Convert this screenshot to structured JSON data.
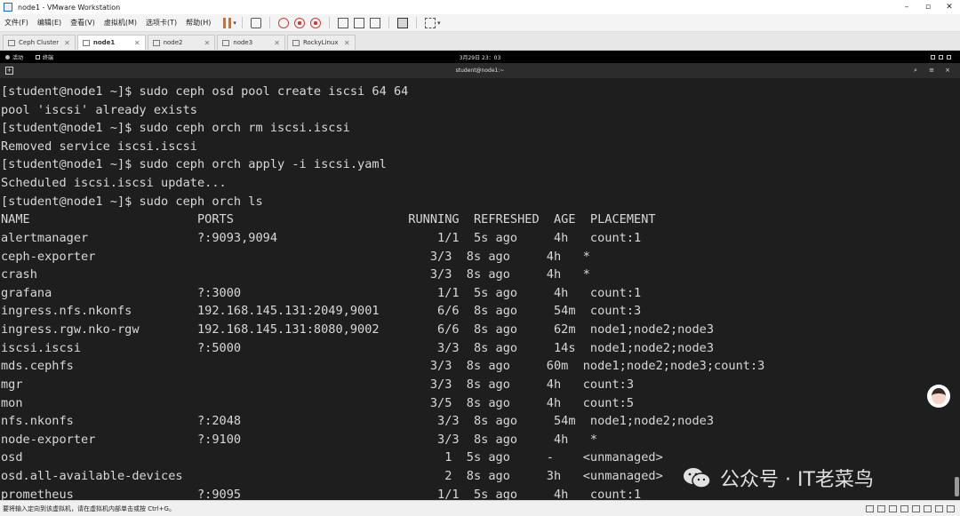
{
  "window": {
    "title": "node1 - VMware Workstation",
    "minimize_glyph": "–",
    "maximize_glyph": "▫",
    "close_glyph": "✕"
  },
  "menubar": {
    "items": [
      "文件(F)",
      "编辑(E)",
      "查看(V)",
      "虚拟机(M)",
      "选项卡(T)",
      "帮助(H)"
    ],
    "pause_color": "#e46a1b"
  },
  "tabs": [
    {
      "label": "Ceph Cluster",
      "active": false
    },
    {
      "label": "node1",
      "active": true
    },
    {
      "label": "node2",
      "active": false
    },
    {
      "label": "node3",
      "active": false
    },
    {
      "label": "RockyLinux",
      "active": false
    }
  ],
  "guest_topbar": {
    "activities": "活动",
    "app": "终端",
    "clock": "3月29日 23：03"
  },
  "terminal_header": {
    "title": "student@node1:~",
    "new_tab_glyph": "+",
    "search_glyph": "⌕",
    "menu_glyph": "≡",
    "close_glyph": "×"
  },
  "terminal": {
    "lines": [
      "[student@node1 ~]$ sudo ceph osd pool create iscsi 64 64",
      "pool 'iscsi' already exists",
      "[student@node1 ~]$ sudo ceph orch rm iscsi.iscsi",
      "Removed service iscsi.iscsi",
      "[student@node1 ~]$ sudo ceph orch apply -i iscsi.yaml",
      "Scheduled iscsi.iscsi update...",
      "[student@node1 ~]$ sudo ceph orch ls",
      "NAME                       PORTS                        RUNNING  REFRESHED  AGE  PLACEMENT",
      "alertmanager               ?:9093,9094                      1/1  5s ago     4h   count:1",
      "ceph-exporter                                              3/3  8s ago     4h   *",
      "crash                                                      3/3  8s ago     4h   *",
      "grafana                    ?:3000                           1/1  5s ago     4h   count:1",
      "ingress.nfs.nkonfs         192.168.145.131:2049,9001        6/6  8s ago     54m  count:3",
      "ingress.rgw.nko-rgw        192.168.145.131:8080,9002        6/6  8s ago     62m  node1;node2;node3",
      "iscsi.iscsi                ?:5000                           3/3  8s ago     14s  node1;node2;node3",
      "mds.cephfs                                                 3/3  8s ago     60m  node1;node2;node3;count:3",
      "mgr                                                        3/3  8s ago     4h   count:3",
      "mon                                                        3/5  8s ago     4h   count:5",
      "nfs.nkonfs                 ?:2048                           3/3  8s ago     54m  node1;node2;node3",
      "node-exporter              ?:9100                           3/3  8s ago     4h   *",
      "osd                                                          1  5s ago     -    <unmanaged>",
      "osd.all-available-devices                                    2  8s ago     3h   <unmanaged>",
      "prometheus                 ?:9095                           1/1  5s ago     4h   count:1"
    ]
  },
  "watermark": {
    "text": "公众号 · IT老菜鸟"
  },
  "statusbar": {
    "hint": "要将输入定向到该虚拟机，请在虚拟机内部单击或按 Ctrl+G。"
  }
}
